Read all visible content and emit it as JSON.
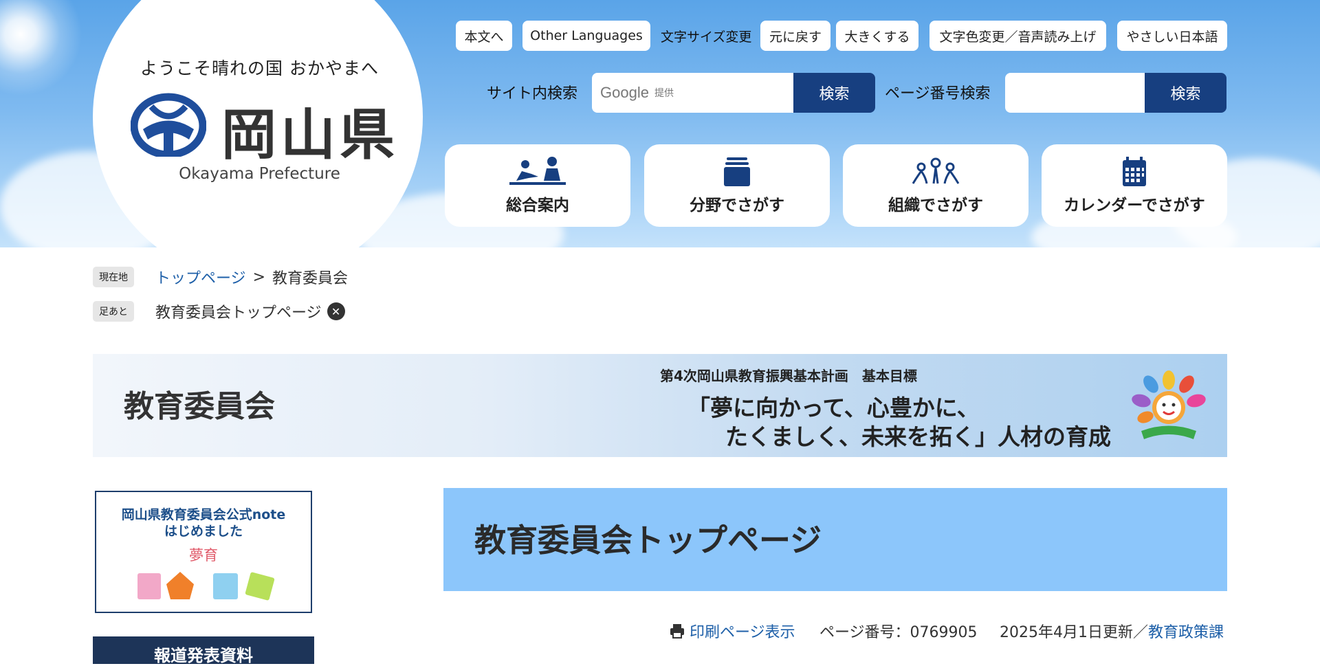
{
  "header": {
    "logo_tagline": "ようこそ晴れの国 おかやまへ",
    "logo_name": "岡山県",
    "logo_en": "Okayama Prefecture",
    "util": {
      "skip_to_content": "本文へ",
      "other_languages": "Other Languages",
      "text_size_label": "文字サイズ変更",
      "reset_size": "元に戻す",
      "enlarge": "大きくする",
      "color_voice": "文字色変更／音声読み上げ",
      "easy_japanese": "やさしい日本語"
    },
    "site_search": {
      "label": "サイト内検索",
      "google_word": "Google",
      "google_sub": "提供",
      "button": "検索"
    },
    "page_search": {
      "label": "ページ番号検索",
      "button": "検索"
    },
    "nav": [
      {
        "label": "総合案内",
        "icon": "people-guide-icon"
      },
      {
        "label": "分野でさがす",
        "icon": "box-stack-icon"
      },
      {
        "label": "組織でさがす",
        "icon": "organization-icon"
      },
      {
        "label": "カレンダーでさがす",
        "icon": "calendar-icon"
      }
    ]
  },
  "breadcrumb": {
    "current_tag": "現在地",
    "top_link": "トップページ",
    "separator": ">",
    "current": "教育委員会",
    "footprint_tag": "足あと",
    "footprint_item": "教育委員会トップページ"
  },
  "banner": {
    "title": "教育委員会",
    "subtitle": "第4次岡山県教育振興基本計画　基本目標",
    "line1": "「夢に向かって、心豊かに、",
    "line2": "たくましく、未来を拓く」人材の育成"
  },
  "sidebar": {
    "note_line1": "岡山県教育委員会公式note",
    "note_line2": "はじめました",
    "note_line3": "夢育",
    "press_label": "報道発表資料"
  },
  "main": {
    "page_title": "教育委員会トップページ",
    "print_link": "印刷ページ表示",
    "page_number": "ページ番号：0769905",
    "updated": "2025年4月1日更新／",
    "department": "教育政策課"
  },
  "colors": {
    "primary_dark": "#173f80",
    "title_box": "#8cc6fb",
    "link": "#1d5fa8"
  }
}
